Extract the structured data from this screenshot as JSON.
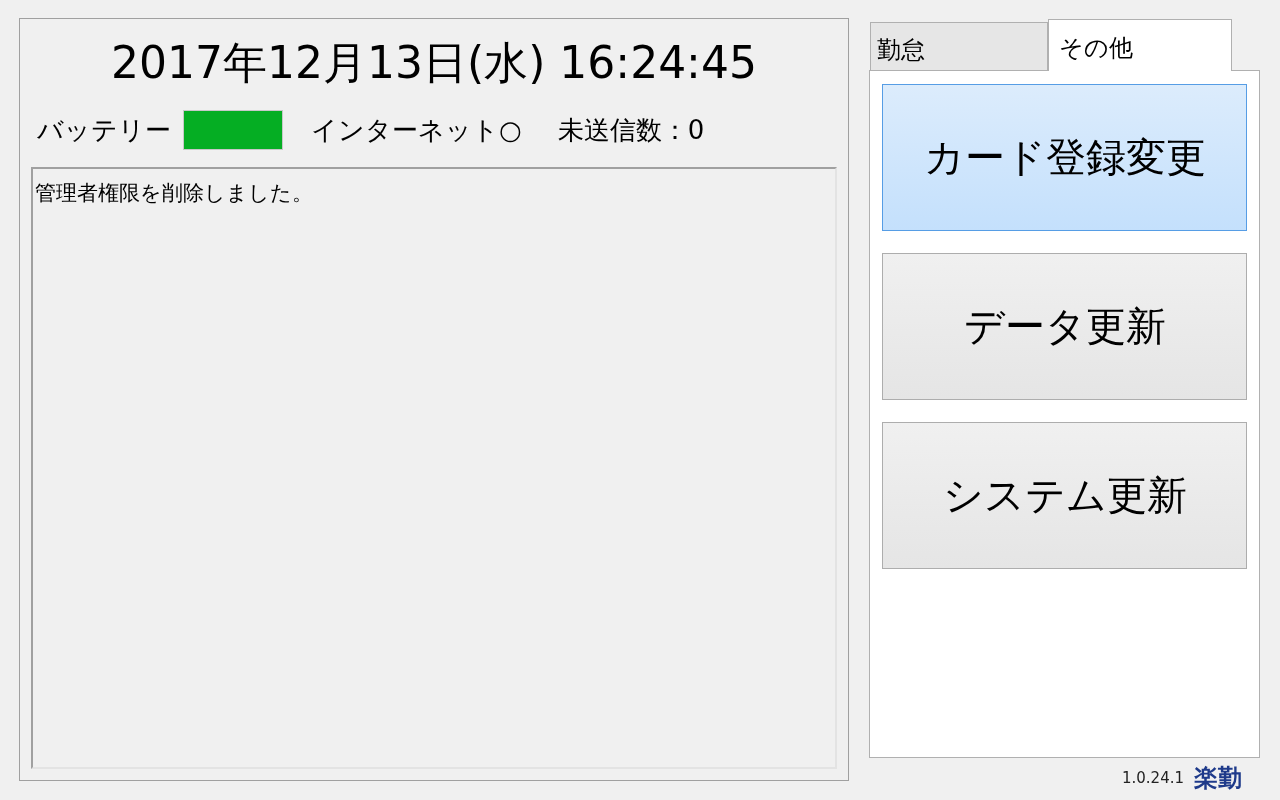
{
  "clock": {
    "datetime": "2017年12月13日(水) 16:24:45"
  },
  "status": {
    "battery": {
      "label": "バッテリー",
      "level": 1
    },
    "internet": "インターネット○",
    "unsent": "未送信数：0"
  },
  "log": {
    "lines": [
      "管理者権限を削除しました。"
    ]
  },
  "tabs": [
    {
      "label": "勤怠",
      "selected": false
    },
    {
      "label": "その他",
      "selected": true
    }
  ],
  "buttons": [
    {
      "label": "カード登録変更",
      "highlighted": true
    },
    {
      "label": "データ更新",
      "highlighted": false
    },
    {
      "label": "システム更新",
      "highlighted": false
    }
  ],
  "footer": {
    "version": "1.0.24.1",
    "logo": "楽勤"
  }
}
